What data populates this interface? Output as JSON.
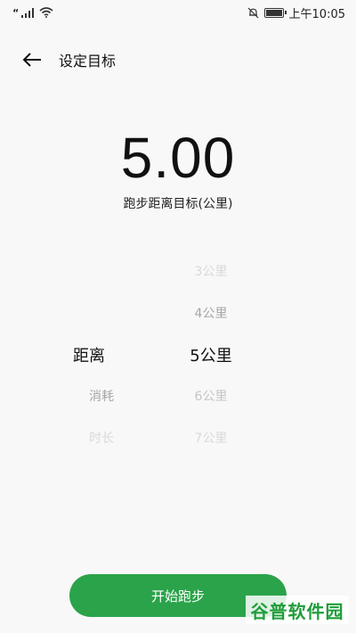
{
  "status_bar": {
    "carrier_mark": "“",
    "time": "上午10:05",
    "icons": [
      "signal-icon",
      "wifi-icon",
      "mute-bell-icon",
      "battery-icon"
    ]
  },
  "header": {
    "title": "设定目标",
    "back_icon": "arrow-left-icon"
  },
  "goal": {
    "value": "5.00",
    "label": "跑步距离目标(公里)"
  },
  "picker": {
    "type_options": [
      "距离",
      "消耗",
      "时长"
    ],
    "selected_type": "距离",
    "value_options": [
      "3公里",
      "4公里",
      "5公里",
      "6公里",
      "7公里"
    ],
    "selected_value": "5公里"
  },
  "actions": {
    "start_label": "开始跑步"
  },
  "watermark": "谷普软件园",
  "colors": {
    "accent": "#2aa34a",
    "background": "#f8f8f8"
  }
}
